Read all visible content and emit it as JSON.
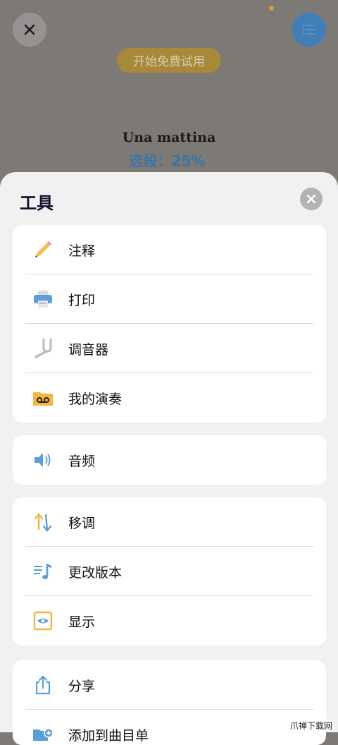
{
  "header": {
    "trial_label": "开始免费试用",
    "song_title": "Una mattina",
    "section_progress": "选段：25%"
  },
  "sheet": {
    "title": "工具",
    "groups": [
      {
        "items": [
          {
            "label": "注释",
            "icon": "pencil-icon"
          },
          {
            "label": "打印",
            "icon": "printer-icon"
          },
          {
            "label": "调音器",
            "icon": "tuning-fork-icon"
          },
          {
            "label": "我的演奏",
            "icon": "recording-folder-icon"
          }
        ]
      },
      {
        "items": [
          {
            "label": "音频",
            "icon": "speaker-icon"
          }
        ]
      },
      {
        "items": [
          {
            "label": "移调",
            "icon": "transpose-arrows-icon"
          },
          {
            "label": "更改版本",
            "icon": "music-list-icon"
          },
          {
            "label": "显示",
            "icon": "eye-icon"
          }
        ]
      },
      {
        "items": [
          {
            "label": "分享",
            "icon": "share-icon"
          },
          {
            "label": "添加到曲目单",
            "icon": "add-folder-icon"
          }
        ]
      }
    ]
  },
  "watermark": "爪禅下载网",
  "colors": {
    "accent": "#3c73a8",
    "overlay": "#7d7a76",
    "sheet_bg": "#f1f1f1"
  }
}
